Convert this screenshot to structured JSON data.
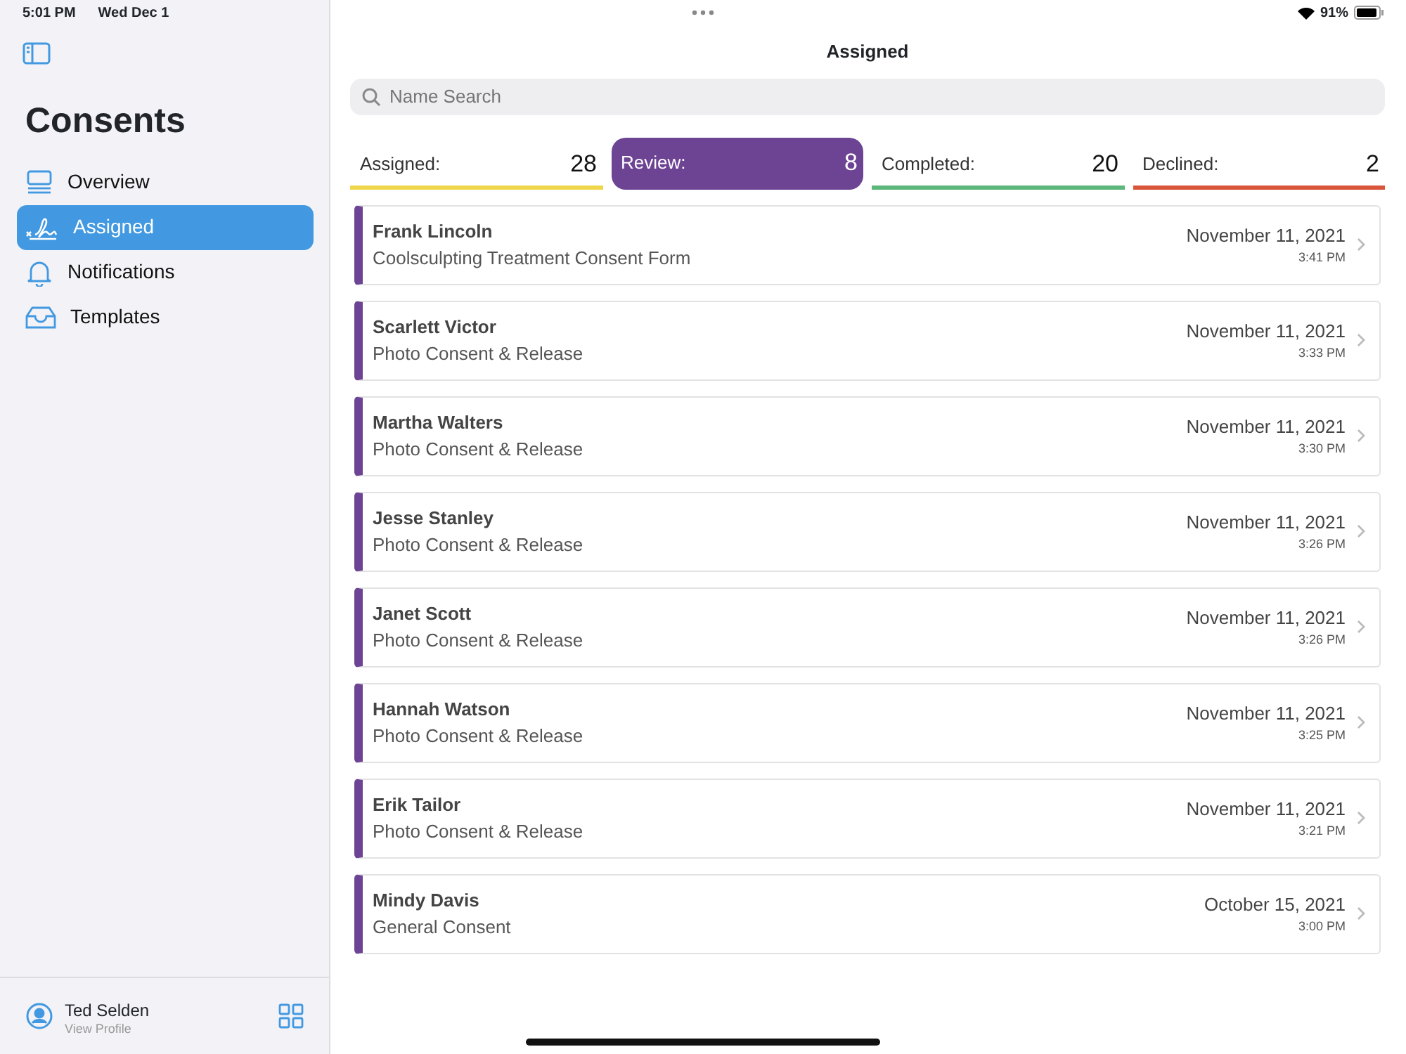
{
  "status_bar": {
    "time": "5:01 PM",
    "date": "Wed Dec 1",
    "battery": "91%"
  },
  "sidebar": {
    "title": "Consents",
    "items": [
      {
        "label": "Overview",
        "selected": false
      },
      {
        "label": "Assigned",
        "selected": true
      },
      {
        "label": "Notifications",
        "selected": false
      },
      {
        "label": "Templates",
        "selected": false
      }
    ],
    "profile": {
      "name": "Ted Selden",
      "subtitle": "View Profile"
    }
  },
  "header": {
    "title": "Assigned"
  },
  "search": {
    "placeholder": "Name Search"
  },
  "tabs": [
    {
      "label": "Assigned:",
      "count": "28",
      "color": "#f0d64a",
      "selected": false
    },
    {
      "label": "Review:",
      "count": "8",
      "color": "#6d4394",
      "selected": true
    },
    {
      "label": "Completed:",
      "count": "20",
      "color": "#5cb87a",
      "selected": false
    },
    {
      "label": "Declined:",
      "count": "2",
      "color": "#d9553a",
      "selected": false
    }
  ],
  "items": [
    {
      "name": "Frank Lincoln",
      "form": "Coolsculpting Treatment Consent Form",
      "date": "November 11, 2021",
      "time": "3:41 PM"
    },
    {
      "name": "Scarlett Victor",
      "form": "Photo Consent & Release",
      "date": "November 11, 2021",
      "time": "3:33 PM"
    },
    {
      "name": "Martha Walters",
      "form": "Photo Consent & Release",
      "date": "November 11, 2021",
      "time": "3:30 PM"
    },
    {
      "name": "Jesse Stanley",
      "form": "Photo Consent & Release",
      "date": "November 11, 2021",
      "time": "3:26 PM"
    },
    {
      "name": "Janet Scott",
      "form": "Photo Consent & Release",
      "date": "November 11, 2021",
      "time": "3:26 PM"
    },
    {
      "name": "Hannah Watson",
      "form": "Photo Consent & Release",
      "date": "November 11, 2021",
      "time": "3:25 PM"
    },
    {
      "name": "Erik Tailor",
      "form": "Photo Consent & Release",
      "date": "November 11, 2021",
      "time": "3:21 PM"
    },
    {
      "name": "Mindy Davis",
      "form": "General Consent",
      "date": "October 15, 2021",
      "time": "3:00 PM"
    }
  ]
}
